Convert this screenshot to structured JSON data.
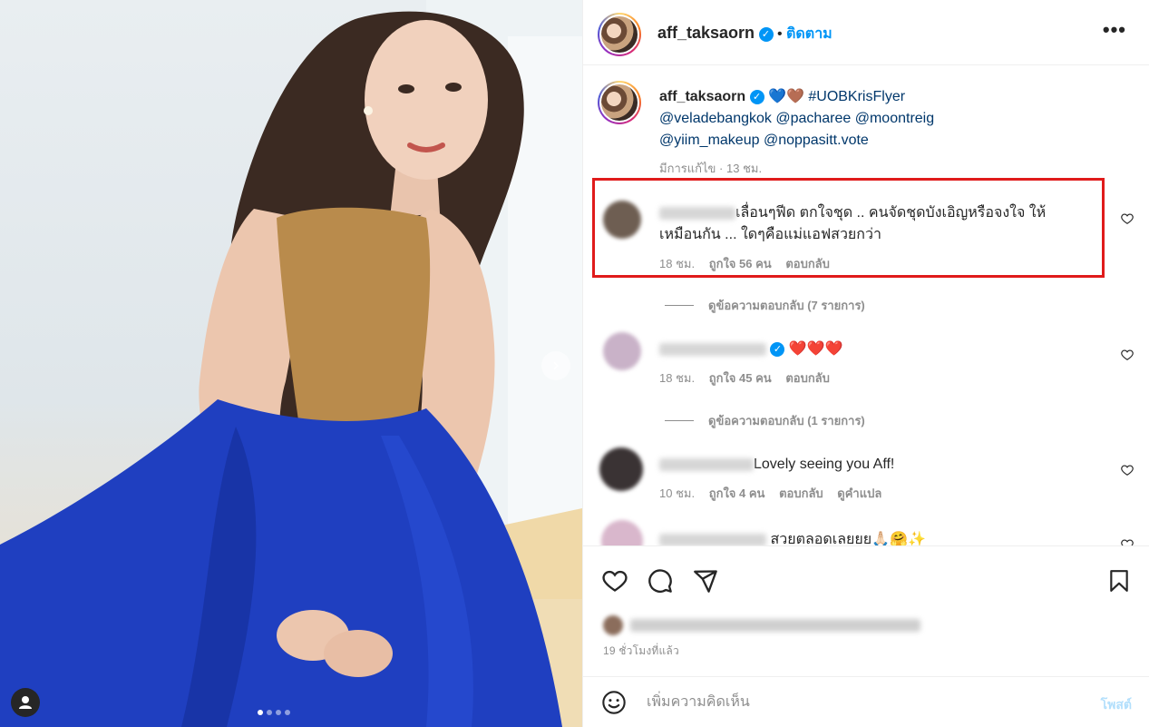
{
  "post": {
    "photo_alt": "",
    "carousel": {
      "count": 4,
      "active": 0
    }
  },
  "header": {
    "username": "aff_taksaorn",
    "separator": "•",
    "follow_label": "ติดตาม",
    "more_label": "•••"
  },
  "caption": {
    "username": "aff_taksaorn",
    "emojis": "💙🤎",
    "hashtag": "#UOBKrisFlyer",
    "mentions_line1": "@veladebangkok @pacharee @moontreig",
    "mentions_line2": "@yiim_makeup @noppasitt.vote",
    "edited": "มีการแก้ไข",
    "dot": "·",
    "time": "13 ชม."
  },
  "comments": [
    {
      "text_line1": "เลื่อนๆฟีด ตกใจชุด .. คนจัดชุดบังเอิญหรือจงใจ ให้",
      "text_line2": "เหมือนกัน ... ใดๆคือแม่แอฟสวยกว่า",
      "time": "18 ชม.",
      "likes": "ถูกใจ 56 คน",
      "reply": "ตอบกลับ",
      "view_replies": "ดูข้อความตอบกลับ (7 รายการ)"
    },
    {
      "text": "❤️❤️❤️",
      "time": "18 ชม.",
      "likes": "ถูกใจ 45 คน",
      "reply": "ตอบกลับ",
      "view_replies": "ดูข้อความตอบกลับ (1 รายการ)"
    },
    {
      "text": "Lovely seeing you Aff!",
      "time": "10 ชม.",
      "likes": "ถูกใจ 4 คน",
      "reply": "ตอบกลับ",
      "translate": "ดูคำแปล"
    },
    {
      "text": "สวยตลอดเลยยย🙏🏻🤗✨"
    }
  ],
  "footer": {
    "time_ago": "19 ชั่วโมงที่แล้ว",
    "comment_placeholder": "เพิ่มความคิดเห็น",
    "post_label": "โพสต์"
  },
  "colors": {
    "accent": "#0095f6",
    "highlight_border": "#e01b1b",
    "muted_text": "#8e8e8e",
    "heart_red": "#ed4956"
  }
}
